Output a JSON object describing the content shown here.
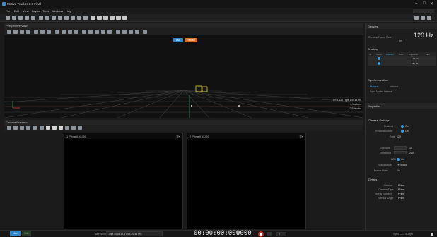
{
  "app": {
    "title": "Motive Tracker 3.0 Final"
  },
  "menu": [
    "File",
    "Edit",
    "View",
    "Layout",
    "Tools",
    "Windows",
    "Help"
  ],
  "perspective": {
    "title": "Perspective View",
    "badge_blue": "Live",
    "badge_orange": "Record"
  },
  "viewport_info": {
    "line1": "FPS 120 | Fps 1.9418 fps",
    "line2": "0 Markers",
    "line3": "0 Selected"
  },
  "camera_panel": {
    "title": "Camera Preview"
  },
  "cameras": [
    {
      "label": "1  PrimeX 41/26",
      "menu": "☰▾"
    },
    {
      "label": "2  PrimeX 41/26",
      "menu": "☰▾"
    }
  ],
  "devices": {
    "title": "Devices",
    "rate_label": "Camera Frame Rate",
    "rate_value": "120 Hz",
    "tracking_label": "Tracking",
    "columns": [
      "ID",
      "Serial",
      "Enabled",
      "Rate",
      "Exposure",
      "LED"
    ],
    "row1": {
      "rate": "120 Hz"
    },
    "row2": {
      "rate": "120 Hz"
    },
    "synchronization": "Synchronization",
    "sync_master": "Master",
    "sync_input": "Internal",
    "sync_rate": "Sync Mode: Internal"
  },
  "properties": {
    "title": "Properties",
    "general_settings": "General Settings",
    "enabled_label": "Enabled",
    "enabled_value": "On",
    "reconstruction_label": "Reconstruction",
    "reconstruction_value": "On",
    "rate_label": "Rate",
    "rate_value": "120",
    "exposure_label": "Exposure",
    "exposure_value": "10",
    "threshold_label": "Threshold",
    "threshold_value": "200",
    "led_label": "LED",
    "led_value": "On",
    "video_mode_label": "Video Mode",
    "video_mode_value": "Precision",
    "frame_rate_label": "Frame Rate",
    "frame_rate_value": "1/4",
    "details_title": "Details",
    "details": [
      {
        "label": "Version",
        "value": "Prime"
      },
      {
        "label": "Camera Type",
        "value": "Prime"
      },
      {
        "label": "Serial Number",
        "value": "Prime"
      },
      {
        "label": "Sensor Angle",
        "value": "Prime"
      }
    ]
  },
  "status": {
    "mode_live": "Live",
    "mode_edit": "Edit",
    "take_name_label": "Take Name",
    "take_name": "Take 2018-12-17 09-30-43 PM",
    "timecode": "00:00:00:000",
    "frames": "0000",
    "frame_count": "0",
    "right_text": "Sync —— 4:3 fps"
  },
  "colors": {
    "accent": "#37a0e6",
    "orange": "#e06a1e",
    "marker": "#e6d23a"
  }
}
